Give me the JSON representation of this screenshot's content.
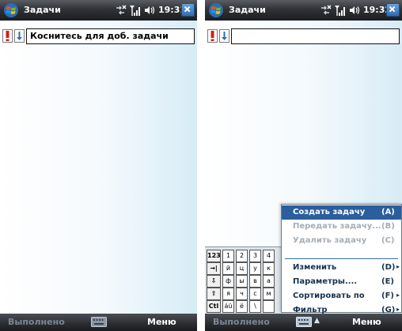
{
  "screens": [
    {
      "title": "Задачи",
      "time": "19:31",
      "input_text": "Коснитесь для доб. задачи",
      "softkeys": {
        "left": "Выполнено",
        "right": "Меню"
      }
    },
    {
      "title": "Задачи",
      "time": "19:32",
      "input_text": "",
      "softkeys": {
        "left": "Выполнено",
        "right": "Меню"
      },
      "keyboard": {
        "rows": [
          [
            "123",
            "1",
            "2",
            "3",
            "4"
          ],
          [
            "→|",
            "й",
            "ц",
            "у",
            "к"
          ],
          [
            "⇩",
            "ф",
            "ы",
            "в",
            "а"
          ],
          [
            "⇧",
            "я",
            "ч",
            "с",
            "м"
          ],
          [
            "Ctl",
            "áü",
            "ё",
            "\\",
            " "
          ]
        ]
      },
      "menu": {
        "items": [
          {
            "label": "Создать задачу",
            "key": "(A)",
            "state": "selected",
            "submenu": false
          },
          {
            "label": "Передать задачу...",
            "key": "(B)",
            "state": "disabled",
            "submenu": false
          },
          {
            "label": "Удалить задачу",
            "key": "(C)",
            "state": "disabled",
            "submenu": false
          },
          {
            "label": "Изменить",
            "key": "(D)",
            "state": "normal",
            "submenu": true
          },
          {
            "label": "Параметры....",
            "key": "(E)",
            "state": "normal",
            "submenu": false
          },
          {
            "label": "Сортировать по",
            "key": "(F)",
            "state": "normal",
            "submenu": true
          },
          {
            "label": "Фильтр",
            "key": "(G)",
            "state": "normal",
            "submenu": true
          }
        ]
      }
    }
  ],
  "icons": {
    "start": "windows-flag-icon",
    "connectivity": "connectivity-icon",
    "signal": "signal-strength-icon",
    "volume": "speaker-icon",
    "close": "close-icon",
    "priority": "exclamation-icon",
    "sort": "sort-arrow-icon",
    "keyboard": "keyboard-icon"
  },
  "colors": {
    "menu_selected": "#2a5e9c",
    "priority_red": "#d81c1c",
    "close_blue": "#2f6cb0"
  }
}
